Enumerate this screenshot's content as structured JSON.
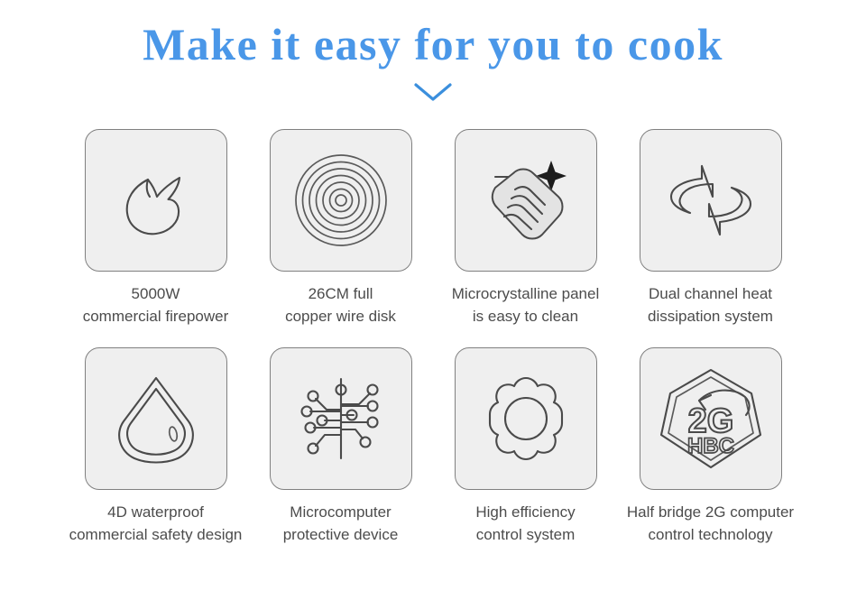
{
  "header": {
    "title": "Make it easy for you to cook",
    "title_color": "#4a97e8",
    "chevron_icon": "chevron-down-icon",
    "chevron_color": "#3b8fdd"
  },
  "theme": {
    "background": "#ffffff",
    "tile_background": "#efefef",
    "tile_border": "#808080",
    "icon_stroke": "#4a4a4a",
    "caption_color": "#4c4c4c"
  },
  "features": [
    {
      "icon": "flame-icon",
      "line1": "5000W",
      "line2": "commercial firepower"
    },
    {
      "icon": "coil-spiral-icon",
      "line1": "26CM full",
      "line2": "copper wire disk"
    },
    {
      "icon": "hand-wiping-cloth-sparkle-icon",
      "line1": "Microcrystalline panel",
      "line2": "is easy to clean"
    },
    {
      "icon": "dual-circulation-arrows-icon",
      "line1": "Dual channel heat",
      "line2": "dissipation system"
    },
    {
      "icon": "water-droplet-icon",
      "line1": "4D waterproof",
      "line2": "commercial safety design"
    },
    {
      "icon": "circuit-board-icon",
      "line1": "Microcomputer",
      "line2": "protective device"
    },
    {
      "icon": "gear-cog-icon",
      "line1": "High efficiency",
      "line2": "control system"
    },
    {
      "icon": "heptagon-2g-hbc-badge-icon",
      "line1": "Half bridge 2G computer",
      "line2": "control technology",
      "badge_primary": "2G",
      "badge_secondary": "HBC"
    }
  ]
}
